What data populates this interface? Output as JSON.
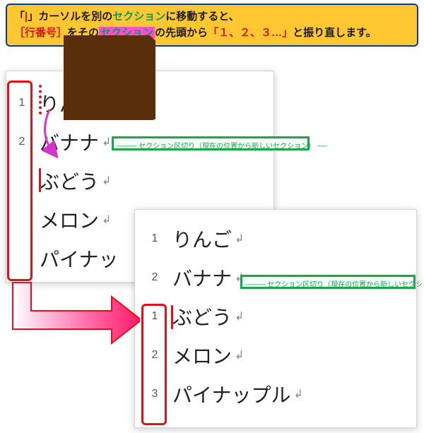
{
  "callout": {
    "p1a": "「",
    "p1b": "」カーソルを別の",
    "p1c": "セクション",
    "p1d": "に移動すると、",
    "p2a": "［行番号］",
    "p2b": "をその",
    "p2c": "セクション",
    "p2d": "の先頭から",
    "p2e": "「１、２、３…」",
    "p2f": "と振り直します。"
  },
  "panelA": {
    "numbers": [
      "1",
      "2"
    ],
    "lines": [
      "りんご",
      "バナナ",
      "ぶどう",
      "メロン",
      "パイナッ"
    ]
  },
  "panelB": {
    "numbersTop": [
      "1",
      "2"
    ],
    "numbersBottom": [
      "1",
      "2",
      "3"
    ],
    "lines": [
      "りんご",
      "バナナ",
      "ぶどう",
      "メロン",
      "パイナップル"
    ]
  },
  "sectionBreak": "──── セクション区切り（現在の位置から新しいセクション） ──",
  "returnMark": "↲"
}
